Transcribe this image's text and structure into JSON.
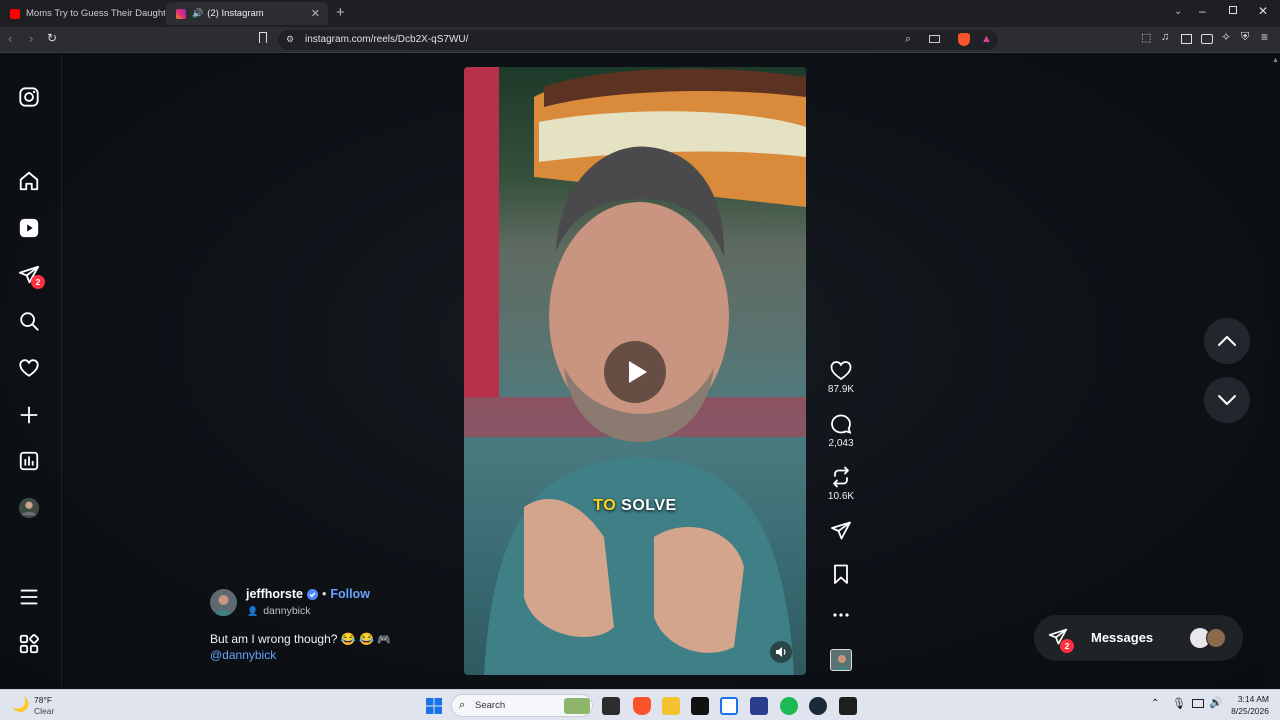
{
  "browser": {
    "tabs": [
      {
        "title": "Moms Try to Guess Their Daughter's",
        "active": false,
        "favicon_color": "#ff0000"
      },
      {
        "title": "(2) Instagram",
        "active": true,
        "favicon_color": "#e1306c"
      }
    ],
    "new_tab_label": "+",
    "url": "instagram.com/reels/Dcb2X-qS7WU/",
    "brave_shield_count": ""
  },
  "sidebar": {
    "logo": "instagram-icon",
    "items": [
      {
        "name": "home",
        "icon": "home-icon"
      },
      {
        "name": "reels",
        "icon": "reels-icon"
      },
      {
        "name": "messages",
        "icon": "direct-icon",
        "badge": "2"
      },
      {
        "name": "search",
        "icon": "search-icon"
      },
      {
        "name": "notifications",
        "icon": "heart-icon"
      },
      {
        "name": "create",
        "icon": "plus-icon"
      },
      {
        "name": "dashboard",
        "icon": "dashboard-icon"
      },
      {
        "name": "profile",
        "icon": "avatar"
      }
    ],
    "bottom": [
      {
        "name": "more",
        "icon": "hamburger-icon"
      },
      {
        "name": "also-from-meta",
        "icon": "grid-icon"
      }
    ]
  },
  "reel": {
    "overlay_caption_highlight": "TO",
    "overlay_caption_rest": "SOLVE",
    "author": "jeffhorste",
    "verified": true,
    "separator": "•",
    "follow_label": "Follow",
    "audio_label": "dannybick",
    "caption_text": "But am I wrong though? 😂 😂",
    "caption_mention": "@dannybick",
    "likes": "87.9K",
    "comments": "2,043",
    "reposts": "10.6K"
  },
  "messages_pill": {
    "label": "Messages",
    "badge": "2"
  },
  "taskbar": {
    "weather_temp": "78°F",
    "weather_desc": "Clear",
    "search_placeholder": "Search",
    "time": "3:14 AM",
    "date": "8/25/2026"
  },
  "colors": {
    "accent_blue": "#4f8bff",
    "badge_red": "#ff3040",
    "caption_yellow": "#ffd31a"
  }
}
